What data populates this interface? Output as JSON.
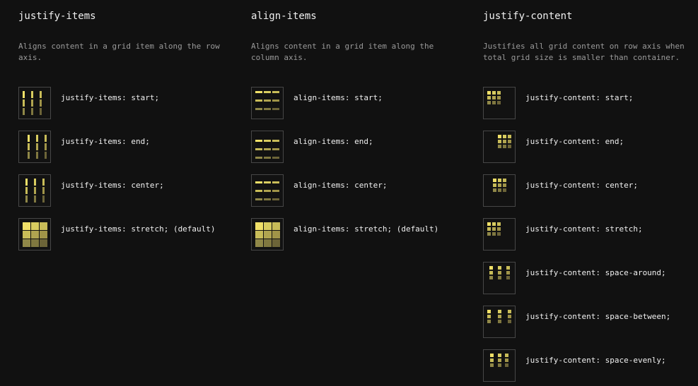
{
  "columns": [
    {
      "key": "justify-items",
      "title": "justify-items",
      "description": "Aligns content in a grid item along the row axis.",
      "items": [
        {
          "label": "justify-items: start;",
          "icon": "justify-items-start-icon"
        },
        {
          "label": "justify-items: end;",
          "icon": "justify-items-end-icon"
        },
        {
          "label": "justify-items: center;",
          "icon": "justify-items-center-icon"
        },
        {
          "label": "justify-items: stretch; (default)",
          "icon": "justify-items-stretch-icon"
        }
      ]
    },
    {
      "key": "align-items",
      "title": "align-items",
      "description": "Aligns content in a grid item along the column axis.",
      "items": [
        {
          "label": "align-items: start;",
          "icon": "align-items-start-icon"
        },
        {
          "label": "align-items: end;",
          "icon": "align-items-end-icon"
        },
        {
          "label": "align-items: center;",
          "icon": "align-items-center-icon"
        },
        {
          "label": "align-items: stretch; (default)",
          "icon": "align-items-stretch-icon"
        }
      ]
    },
    {
      "key": "justify-content",
      "title": "justify-content",
      "description": "Justifies all grid content on row axis when total grid size is smaller than container.",
      "items": [
        {
          "label": "justify-content: start;",
          "icon": "justify-content-start-icon"
        },
        {
          "label": "justify-content: end;",
          "icon": "justify-content-end-icon"
        },
        {
          "label": "justify-content: center;",
          "icon": "justify-content-center-icon"
        },
        {
          "label": "justify-content: stretch;",
          "icon": "justify-content-stretch-icon"
        },
        {
          "label": "justify-content: space-around;",
          "icon": "justify-content-space-around-icon"
        },
        {
          "label": "justify-content: space-between;",
          "icon": "justify-content-space-between-icon"
        },
        {
          "label": "justify-content: space-evenly;",
          "icon": "justify-content-space-evenly-icon"
        }
      ]
    }
  ],
  "colors": {
    "cells": [
      "#f0e068",
      "#d8cc60",
      "#c8bc58",
      "#c8bc58",
      "#b0a450",
      "#a09448",
      "#908848",
      "#807840",
      "#6c6438"
    ]
  }
}
